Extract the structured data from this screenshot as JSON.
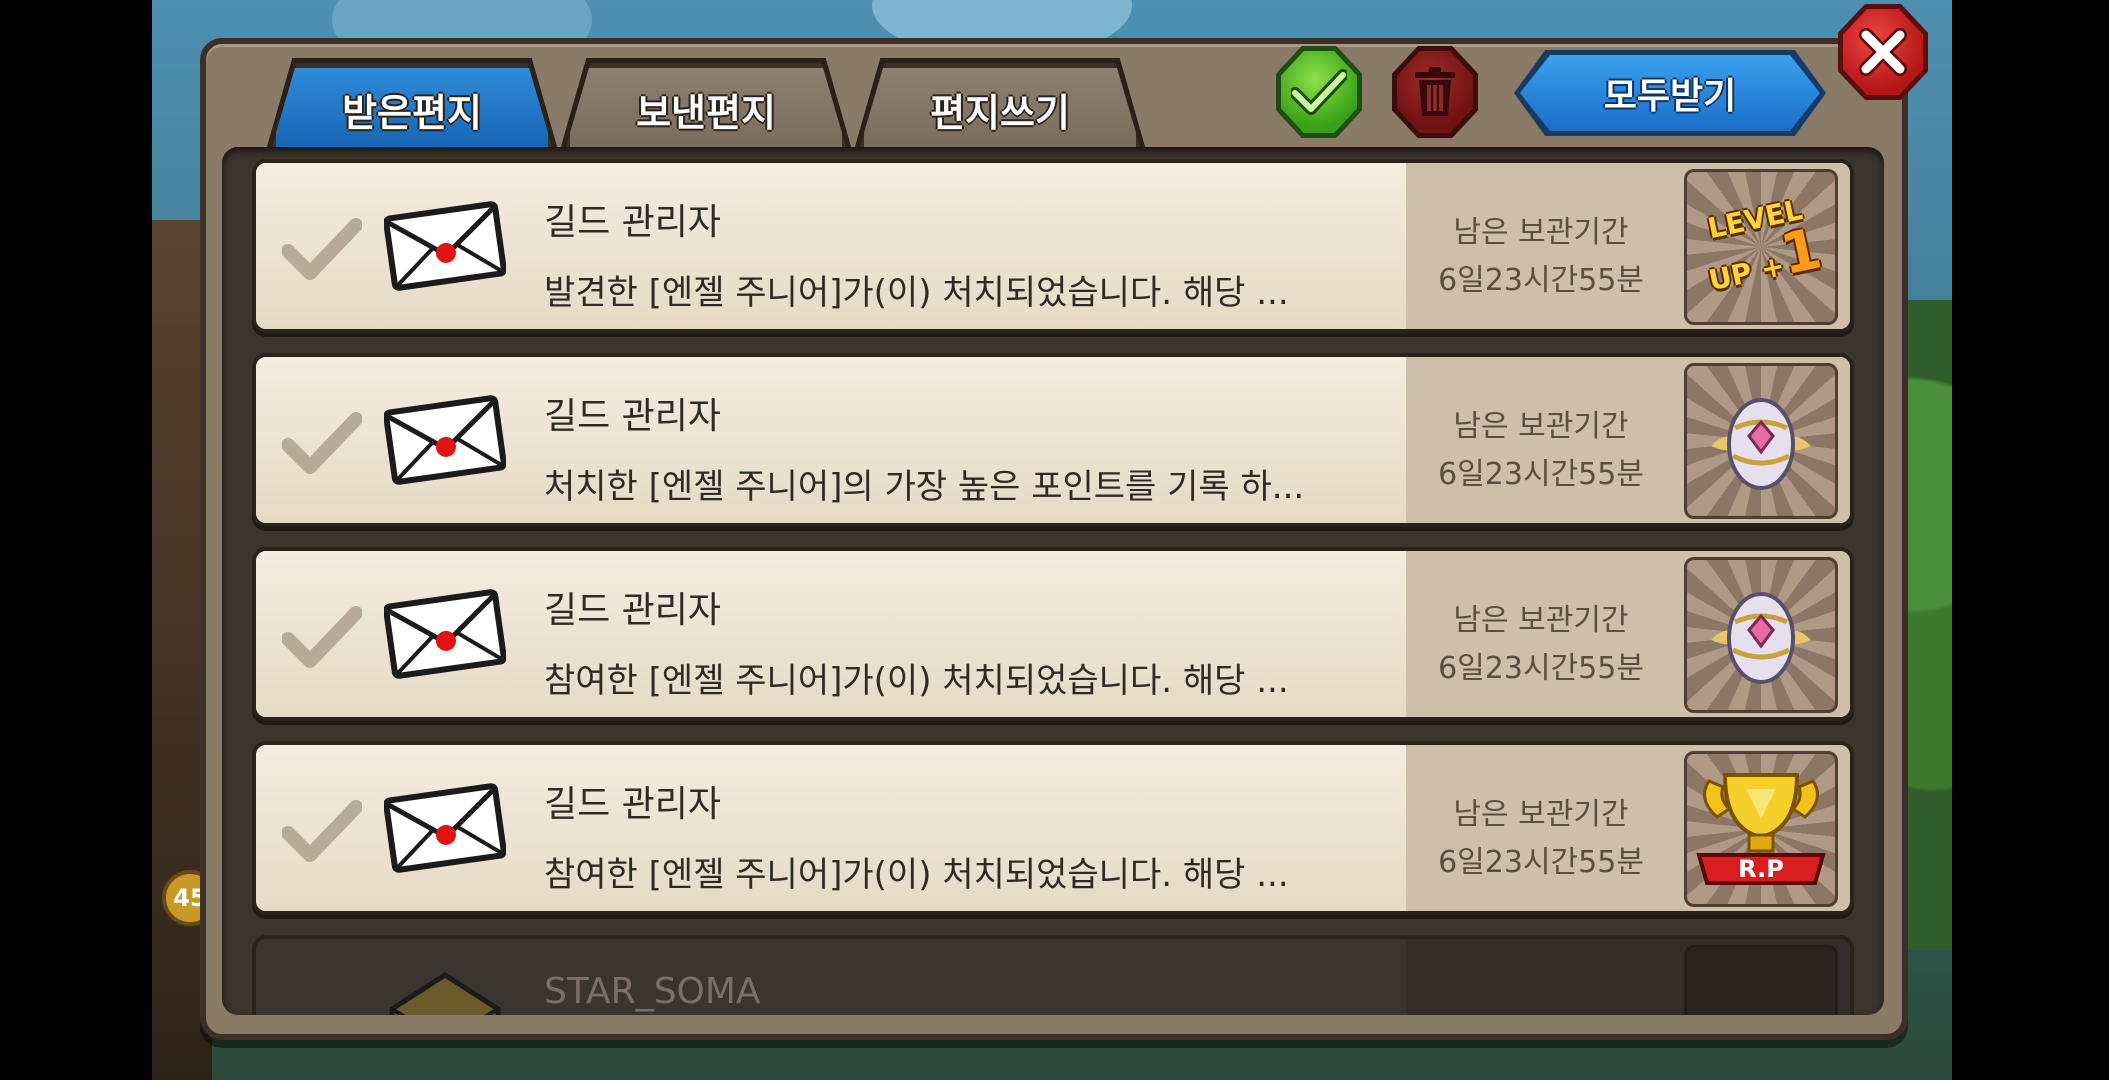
{
  "tabs": [
    {
      "label": "받은편지",
      "active": true
    },
    {
      "label": "보낸편지",
      "active": false
    },
    {
      "label": "편지쓰기",
      "active": false
    }
  ],
  "toolbar": {
    "receive_all_label": "모두받기"
  },
  "background": {
    "level_badge": "45"
  },
  "mails": [
    {
      "sender": "길드 관리자",
      "text": "발견한 [엔젤 주니어]가(이) 처치되었습니다. 해당 ...",
      "retention_label": "남은 보관기간",
      "retention_time": "6일23시간55분",
      "reward": "levelup-icon",
      "reward_text": "LEVEL UP + 1"
    },
    {
      "sender": "길드 관리자",
      "text": "처치한 [엔젤 주니어]의 가장 높은 포인트를 기록 하...",
      "retention_label": "남은 보관기간",
      "retention_time": "6일23시간55분",
      "reward": "egg-icon"
    },
    {
      "sender": "길드 관리자",
      "text": "참여한 [엔젤 주니어]가(이) 처치되었습니다. 해당 ...",
      "retention_label": "남은 보관기간",
      "retention_time": "6일23시간55분",
      "reward": "egg-icon"
    },
    {
      "sender": "길드 관리자",
      "text": "참여한 [엔젤 주니어]가(이) 처치되었습니다. 해당 ...",
      "retention_label": "남은 보관기간",
      "retention_time": "6일23시간55분",
      "reward": "trophy-icon",
      "reward_text": "R.P"
    },
    {
      "sender": "STAR_SOMA",
      "text": "",
      "retention_label": "",
      "retention_time": "",
      "reward": "empty"
    }
  ],
  "colors": {
    "active_tab": "#1f78cc",
    "modal_bg": "#8a7a68",
    "row_bg": "#ece2d2",
    "confirm_green": "#38a018",
    "delete_red": "#6e1212",
    "close_red": "#c41c1c"
  }
}
